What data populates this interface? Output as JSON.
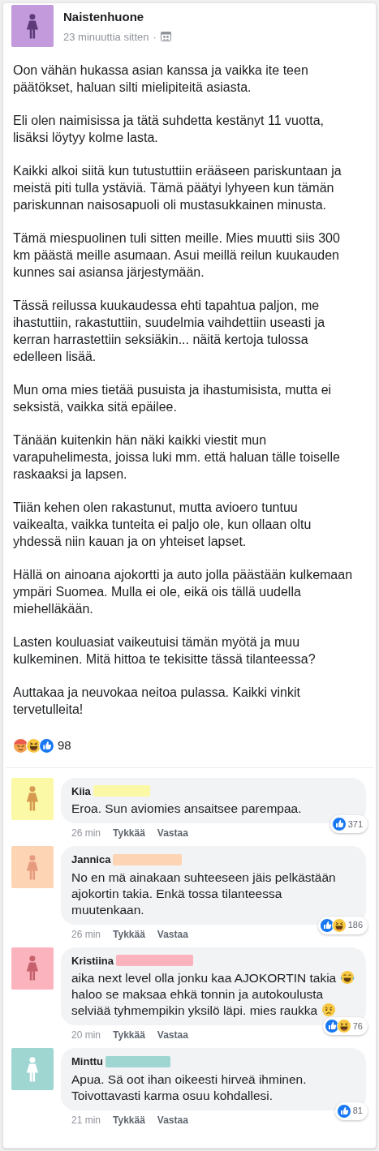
{
  "post": {
    "author": "Naistenhuone",
    "time": "23 minuuttia sitten",
    "separator": "·",
    "avatar": {
      "color": "#c39bdc",
      "figure": {
        "color": "#5d3a78"
      }
    },
    "paragraphs": [
      "Oon vähän hukassa asian kanssa ja vaikka ite teen päätökset, haluan silti mielipiteitä asiasta.",
      "Eli olen naimisissa ja tätä suhdetta kestänyt 11 vuotta, lisäksi löytyy kolme lasta.",
      "Kaikki alkoi siitä kun tutustuttiin erääseen pariskuntaan ja meistä piti tulla ystäviä. Tämä päätyi lyhyeen kun tämän pariskunnan naisosapuoli oli mustasukkainen minusta.",
      "Tämä miespuolinen tuli sitten meille. Mies muutti siis 300 km päästä meille asumaan. Asui meillä reilun kuukauden kunnes sai asiansa järjestymään.",
      "Tässä reilussa kuukaudessa ehti tapahtua paljon, me ihastuttiin, rakastuttiin, suudelmia vaihdettiin useasti ja kerran harrastettiin seksiäkin... näitä kertoja tulossa edelleen lisää.",
      "Mun oma mies tietää pusuista ja ihastumisista, mutta ei seksistä, vaikka sitä epäilee.",
      "Tänään kuitenkin hän näki kaikki viestit mun varapuhelimesta, joissa luki mm. että haluan tälle toiselle raskaaksi ja lapsen.",
      "Tiiän kehen olen rakastunut, mutta avioero tuntuu vaikealta, vaikka tunteita ei paljo ole, kun ollaan oltu yhdessä niin kauan ja on yhteiset lapset.",
      "Hällä on ainoana ajokortti ja auto jolla päästään kulkemaan ympäri Suomea. Mulla ei ole, eikä ois tällä uudella miehelläkään.",
      "Lasten kouluasiat vaikeutuisi tämän myötä ja muu kulkeminen. Mitä hittoa te tekisitte tässä tilanteessa?",
      "Auttakaa ja neuvokaa neitoa pulassa. Kaikki vinkit tervetulleita!"
    ],
    "reactions": [
      {
        "kind": "angry"
      },
      {
        "kind": "haha"
      },
      {
        "kind": "like"
      }
    ],
    "reaction_count": "98"
  },
  "comments": [
    {
      "name": "Kiia",
      "avatar": {
        "color": "#fbf8a6",
        "figure": {
          "color": "#d69a50"
        }
      },
      "redaction": {
        "color": "#fbf8a6"
      },
      "parts": [
        {
          "kind": "text",
          "text": "Eroa. Sun aviomies ansaitsee parempaa."
        }
      ],
      "time": "26 min",
      "like": "Tykkää",
      "reply": "Vastaa",
      "reactions": [
        {
          "kind": "like"
        }
      ],
      "count": "371"
    },
    {
      "name": "Jannica",
      "avatar": {
        "color": "#fdd5b5",
        "figure": {
          "color": "#e69a7e"
        }
      },
      "redaction": {
        "color": "#fdd5b5"
      },
      "parts": [
        {
          "kind": "text",
          "text": "No en mä ainakaan suhteeseen jäis pelkästään ajokortin takia. Enkä tossa tilanteessa muutenkaan."
        }
      ],
      "time": "26 min",
      "like": "Tykkää",
      "reply": "Vastaa",
      "reactions": [
        {
          "kind": "like"
        },
        {
          "kind": "haha"
        }
      ],
      "count": "186"
    },
    {
      "name": "Kristiina",
      "avatar": {
        "color": "#fbb4be",
        "figure": {
          "color": "#c5606c"
        }
      },
      "redaction": {
        "color": "#fbb4be"
      },
      "parts": [
        {
          "kind": "text",
          "text": "aika next level olla jonku kaa AJOKORTIN takia "
        },
        {
          "kind": "joy"
        },
        {
          "kind": "text",
          "text": " haloo se maksaa ehkä tonnin ja autokoulusta selviää tyhmempikin yksilö läpi. mies raukka "
        },
        {
          "kind": "sad"
        }
      ],
      "time": "20 min",
      "like": "Tykkää",
      "reply": "Vastaa",
      "reactions": [
        {
          "kind": "like"
        },
        {
          "kind": "haha"
        }
      ],
      "count": "76"
    },
    {
      "name": "Minttu",
      "avatar": {
        "color": "#9fd6d2",
        "figure": {
          "color": "#ffffff"
        }
      },
      "redaction": {
        "color": "#9fd6d2"
      },
      "parts": [
        {
          "kind": "text",
          "text": "Apua. Sä oot ihan oikeesti hirveä ihminen. Toivottavasti karma osuu kohdallesi."
        }
      ],
      "time": "21 min",
      "like": "Tykkää",
      "reply": "Vastaa",
      "reactions": [
        {
          "kind": "like"
        }
      ],
      "count": "81"
    }
  ]
}
